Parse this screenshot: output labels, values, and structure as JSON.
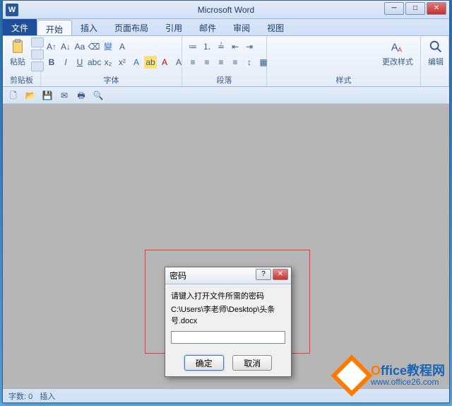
{
  "titlebar": {
    "app_icon": "W",
    "title": "Microsoft Word"
  },
  "tabs": {
    "file": "文件",
    "items": [
      "开始",
      "插入",
      "页面布局",
      "引用",
      "邮件",
      "审阅",
      "视图"
    ],
    "active": 0
  },
  "ribbon": {
    "clipboard": {
      "label": "剪贴板",
      "paste": "粘贴"
    },
    "font": {
      "label": "字体"
    },
    "paragraph": {
      "label": "段落"
    },
    "styles": {
      "label": "样式",
      "change": "更改样式"
    },
    "editing": {
      "label": "编辑"
    }
  },
  "dialog": {
    "title": "密码",
    "prompt": "请键入打开文件所需的密码",
    "path": "C:\\Users\\李老师\\Desktop\\头条号.docx",
    "ok": "确定",
    "cancel": "取消"
  },
  "status": {
    "words_label": "字数: 0",
    "mode": "插入"
  },
  "watermark": {
    "brand_o": "O",
    "brand_rest": "ffice教程网",
    "url": "www.office26.com"
  }
}
